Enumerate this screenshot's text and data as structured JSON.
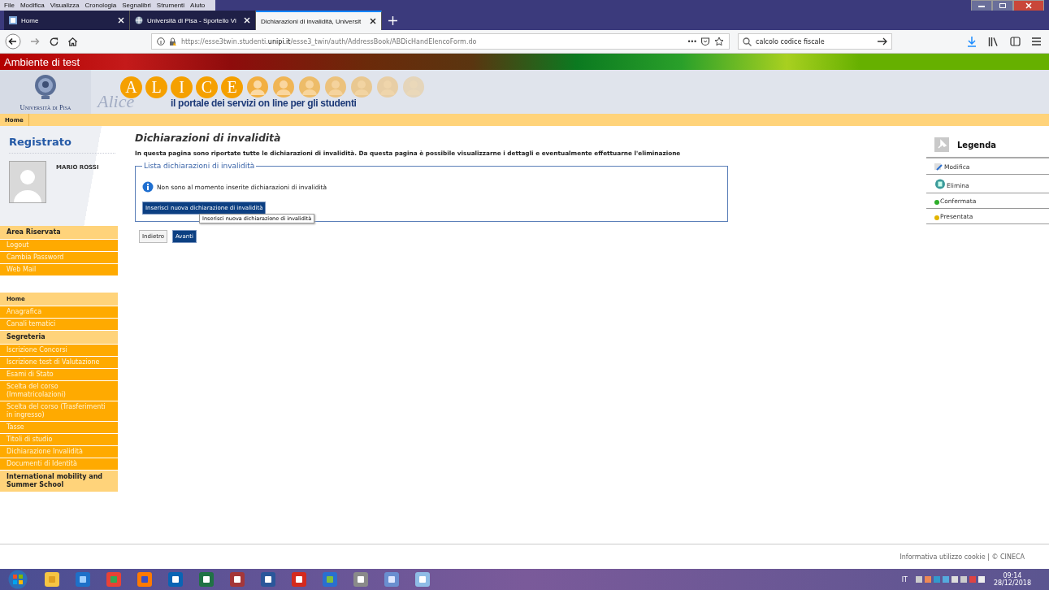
{
  "menu_bar": [
    "File",
    "Modifica",
    "Visualizza",
    "Cronologia",
    "Segnalibri",
    "Strumenti",
    "Aiuto"
  ],
  "tabs": [
    {
      "label": "Home",
      "selected": false,
      "kind": "page"
    },
    {
      "label": "Università di Pisa - Sportello Vi",
      "selected": false,
      "kind": "site"
    },
    {
      "label": "Dichiarazioni di invalidità, Universit",
      "selected": true,
      "kind": "none"
    }
  ],
  "nav": {
    "url": "https://esse3twin.studenti.**unipi.it**/esse3_twin/auth/AddressBook/ABDicHandElencoForm.do",
    "search_value": "calcolo codice fiscale",
    "page_actions": "•••"
  },
  "banner": "Ambiente di test",
  "header": {
    "university": "Università di Pisa",
    "logo_script": "Alice",
    "letters": [
      "A",
      "L",
      "I",
      "C",
      "E"
    ],
    "tagline": "il portale dei servizi on line per gli studenti"
  },
  "breadcrumb": "Home",
  "sidebar": {
    "title": "Registrato",
    "user": "MARIO ROSSI",
    "reserved": {
      "heading": "Area Riservata",
      "items": [
        "Logout",
        "Cambia Password",
        "Web Mail"
      ]
    },
    "menu": [
      {
        "label": "Home",
        "kind": "heading"
      },
      {
        "label": "Anagrafica",
        "kind": "link"
      },
      {
        "label": "Canali tematici",
        "kind": "link"
      },
      {
        "label": "Segreteria",
        "kind": "section"
      },
      {
        "label": "Iscrizione Concorsi",
        "kind": "link"
      },
      {
        "label": "Iscrizione test di Valutazione",
        "kind": "link"
      },
      {
        "label": "Esami di Stato",
        "kind": "link"
      },
      {
        "label": "Scelta del corso (Immatricolazioni)",
        "kind": "link"
      },
      {
        "label": "Scelta del corso (Trasferimenti in ingresso)",
        "kind": "link"
      },
      {
        "label": "Tasse",
        "kind": "link"
      },
      {
        "label": "Titoli di studio",
        "kind": "link"
      },
      {
        "label": "Dichiarazione Invalidità",
        "kind": "link"
      },
      {
        "label": "Documenti di Identità",
        "kind": "link"
      },
      {
        "label": "International mobility and Summer School",
        "kind": "section"
      }
    ]
  },
  "main": {
    "title": "Dichiarazioni di invalidità",
    "description": "In questa pagina sono riportate tutte le dichiarazioni di invalidità. Da questa pagina è possibile visualizzarne i dettagli e eventualmente effettuarne l'eliminazione",
    "panel": {
      "legend": "Lista dichiarazioni di invalidità",
      "message": "Non sono al momento inserite dichiarazioni di invalidità",
      "button": "Inserisci nuova dichiarazione di invalidità",
      "tooltip": "Inserisci nuova dichiarazione di invalidità"
    },
    "buttons": [
      {
        "label": "Indietro",
        "kind": "secondary"
      },
      {
        "label": "Avanti",
        "kind": "primary"
      }
    ]
  },
  "legend": {
    "title": "Legenda",
    "items": [
      {
        "label": "Modifica",
        "kind": "edit"
      },
      {
        "label": "Elimina",
        "kind": "delete"
      },
      {
        "label": "Confermata",
        "kind": "dot",
        "color": "#2fae2a"
      },
      {
        "label": "Presentata",
        "kind": "dot",
        "color": "#e2b400"
      }
    ]
  },
  "footer": "Informativa utilizzo cookie | © CINECA",
  "taskbar": {
    "language": "IT",
    "time": "09:14",
    "date": "28/12/2018"
  }
}
